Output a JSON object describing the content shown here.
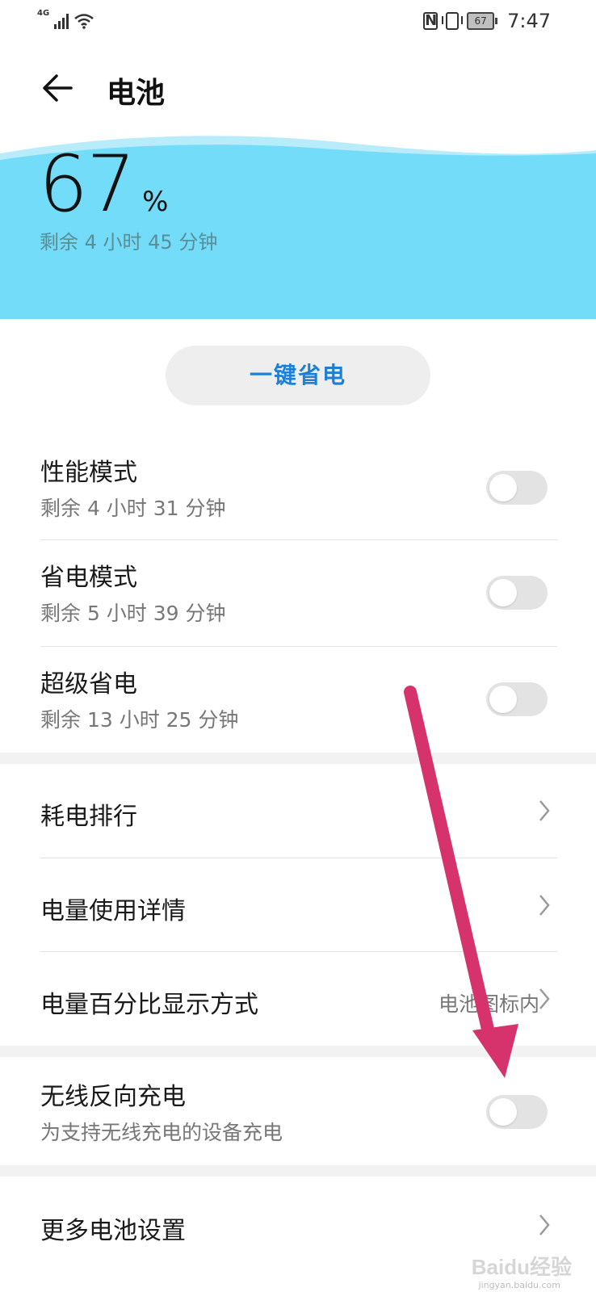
{
  "status_bar": {
    "network": "4G",
    "battery": "67",
    "time": "7:47"
  },
  "header": {
    "title": "电池"
  },
  "battery": {
    "percent": "67",
    "unit": "%",
    "remaining": "剩余 4 小时 45 分钟"
  },
  "one_key_save": {
    "label": "一键省电"
  },
  "modes": [
    {
      "title": "性能模式",
      "subtitle": "剩余 4 小时 31 分钟",
      "enabled": false
    },
    {
      "title": "省电模式",
      "subtitle": "剩余 5 小时 39 分钟",
      "enabled": false
    },
    {
      "title": "超级省电",
      "subtitle": "剩余 13 小时 25 分钟",
      "enabled": false
    }
  ],
  "menu": [
    {
      "title": "耗电排行",
      "value": ""
    },
    {
      "title": "电量使用详情",
      "value": ""
    },
    {
      "title": "电量百分比显示方式",
      "value": "电池图标内"
    }
  ],
  "wireless_reverse": {
    "title": "无线反向充电",
    "subtitle": "为支持无线充电的设备充电",
    "enabled": false
  },
  "more_settings": {
    "title": "更多电池设置"
  },
  "colors": {
    "wave": "#73dcf9",
    "wave_light": "#b8ecfb",
    "accent": "#1f7fd6",
    "arrow": "#d6336c"
  },
  "watermark": {
    "logo": "Baidu经验",
    "url": "jingyan.baidu.com"
  }
}
